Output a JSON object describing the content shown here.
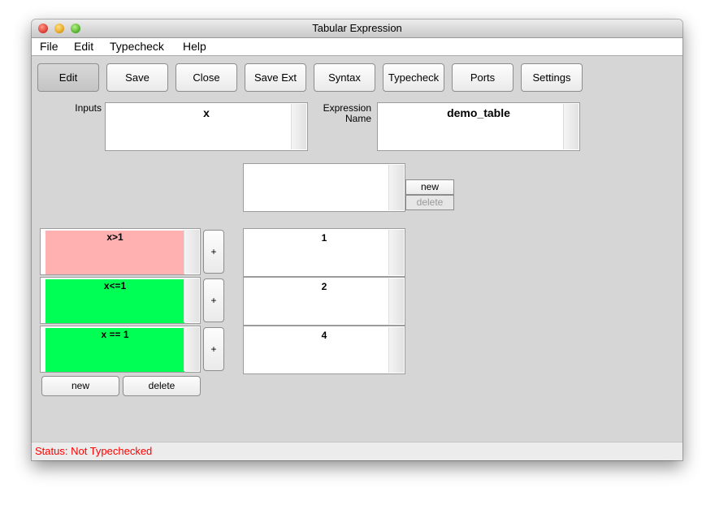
{
  "window": {
    "title": "Tabular Expression"
  },
  "menu": [
    "File",
    "Edit",
    "Typecheck",
    "Help"
  ],
  "toolbar": [
    "Edit",
    "Save",
    "Close",
    "Save Ext",
    "Syntax",
    "Typecheck",
    "Ports",
    "Settings"
  ],
  "inputs": {
    "label": "Inputs",
    "value": "x"
  },
  "expression_name": {
    "label_line1": "Expression",
    "label_line2": "Name",
    "value": "demo_table"
  },
  "header_cell": {
    "value": "",
    "new_label": "new",
    "delete_label": "delete"
  },
  "rows": [
    {
      "condition": "x>1",
      "condition_color": "#ffb0b0",
      "plus_label": "+",
      "result": "1"
    },
    {
      "condition": "x<=1",
      "condition_color": "#00ff55",
      "plus_label": "+",
      "result": "2"
    },
    {
      "condition": "x == 1",
      "condition_color": "#00ff55",
      "plus_label": "+",
      "result": "4"
    }
  ],
  "row_buttons": {
    "new_label": "new",
    "delete_label": "delete"
  },
  "status": {
    "text": "Status: Not Typechecked",
    "color": "#ff0000"
  }
}
